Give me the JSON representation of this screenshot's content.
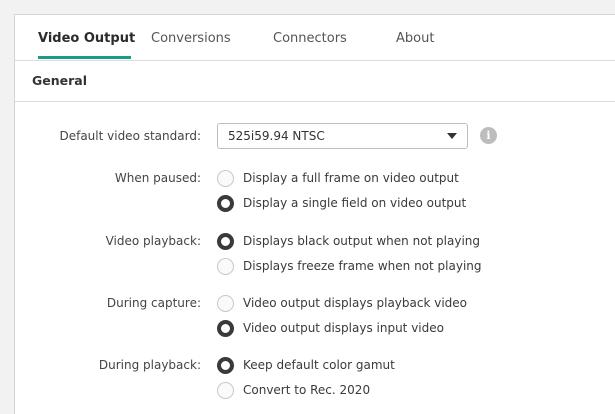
{
  "tabs": [
    "Video Output",
    "Conversions",
    "Connectors",
    "About"
  ],
  "section_title": "General",
  "default_video_standard": {
    "label": "Default video standard:",
    "value": "525i59.94 NTSC"
  },
  "groups": [
    {
      "label": "When paused:",
      "options": [
        "Display a full frame on video output",
        "Display a single field on video output"
      ],
      "selected": 1
    },
    {
      "label": "Video playback:",
      "options": [
        "Displays black output when not playing",
        "Displays freeze frame when not playing"
      ],
      "selected": 0
    },
    {
      "label": "During capture:",
      "options": [
        "Video output displays playback video",
        "Video output displays input video"
      ],
      "selected": 1
    },
    {
      "label": "During playback:",
      "options": [
        "Keep default color gamut",
        "Convert to Rec. 2020"
      ],
      "selected": 0
    }
  ],
  "icons": {
    "info": "info-icon",
    "dropdown": "chevron-down-icon"
  },
  "colors": {
    "accent": "#1c9c86"
  }
}
